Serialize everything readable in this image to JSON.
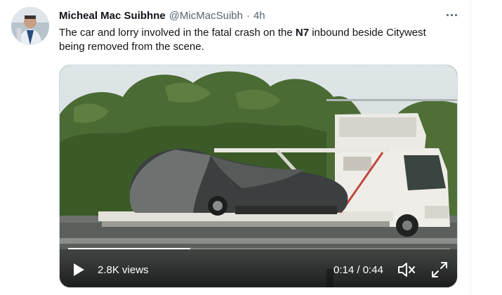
{
  "tweet": {
    "author_name": "Micheal Mac Suibhne",
    "author_handle": "@MicMacSuibh",
    "separator": "·",
    "timestamp": "4h",
    "text_before": "The car and lorry involved in the fatal crash on the ",
    "text_bold": "N7",
    "text_after": " inbound beside Citywest being removed from the scene."
  },
  "video": {
    "views": "2.8K views",
    "current_time": "0:14",
    "time_separator": " / ",
    "duration": "0:44",
    "progress_fraction": 0.32
  },
  "icons": {
    "more": "more-horizontal-icon",
    "play": "play-icon",
    "volume": "volume-off-icon",
    "fullscreen": "fullscreen-icon"
  },
  "colors": {
    "text_primary": "#0f1419",
    "text_secondary": "#536471",
    "border": "#cfd9de"
  }
}
